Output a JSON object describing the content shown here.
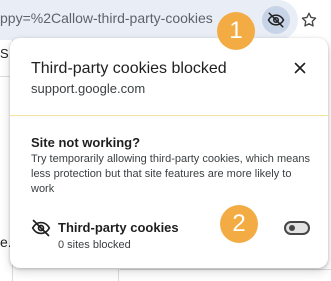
{
  "omnibox": {
    "url_fragment": "ppy=%2Callow-third-party-cookies",
    "eye_icon": "eye-off-icon",
    "star_icon": "star-icon"
  },
  "page": {
    "fragment_top": "S",
    "fragment_bottom": "e."
  },
  "popup": {
    "title": "Third-party cookies blocked",
    "subtitle": "support.google.com",
    "close_icon": "close-icon",
    "section_heading": "Site not working?",
    "section_body": "Try temporarily allowing third-party cookies, which means less protection but that site features are more likely to work",
    "toggle_row": {
      "icon": "eye-off-icon",
      "title": "Third-party cookies",
      "subtitle": "0 sites blocked",
      "enabled": false
    }
  },
  "markers": [
    {
      "label": "1"
    },
    {
      "label": "2"
    }
  ],
  "colors": {
    "marker": "#f3ac44",
    "divider": "#f2e3a3",
    "omnibox": "#e9eef6"
  }
}
